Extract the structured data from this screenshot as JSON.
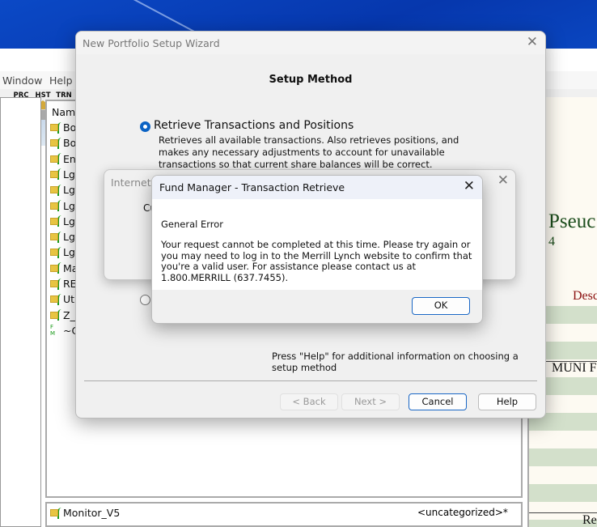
{
  "app": {
    "menu": [
      "Window",
      "Help"
    ],
    "toolbar": [
      {
        "label": "PRC",
        "icon": "up-arrow-icon",
        "color": "#3a78d8"
      },
      {
        "label": "HST",
        "icon": "up-arrow-icon",
        "color": "#d4a93a"
      },
      {
        "label": "TRN",
        "icon": "up-arrow-icon",
        "color": "#1e9a4a"
      }
    ],
    "list": {
      "header": "Name",
      "items": [
        "Bo",
        "Bo",
        "En",
        "Lg",
        "Lg",
        "Lg",
        "Lg",
        "Lg",
        "Lg",
        "Ma",
        "RE",
        "Ut",
        "Z_",
        "~C"
      ]
    },
    "bottom_item": {
      "name": "Monitor_V5",
      "category": "<uncategorized>*"
    },
    "right_pane": {
      "title": "Pseuc",
      "subtitle": "4",
      "desc_label": "Desc",
      "section": "MUNI F",
      "footer": "Re"
    }
  },
  "wizard": {
    "title": "New Portfolio Setup Wizard",
    "heading": "Setup Method",
    "option1": {
      "label": "Retrieve Transactions and Positions",
      "description": "Retrieves all available transactions.  Also retrieves positions, and makes any necessary adjustments to account for unavailable transactions so that current share balances will be correct.",
      "selected": true
    },
    "option2": {
      "selected": false
    },
    "help_text": "Press \"Help\" for additional information on choosing a setup method",
    "buttons": {
      "back": "< Back",
      "next": "Next >",
      "cancel": "Cancel",
      "help": "Help"
    }
  },
  "internet_dialog": {
    "title": "Internet R",
    "text": "Cu"
  },
  "error_dialog": {
    "title": "Fund Manager - Transaction Retrieve",
    "heading": "General Error",
    "message": "Your request cannot be completed at this time. Please try again or you may need to log in to the Merrill Lynch website to confirm that you're a valid user. For assistance please contact us at 1.800.MERRILL (637.7455).",
    "ok": "OK"
  }
}
